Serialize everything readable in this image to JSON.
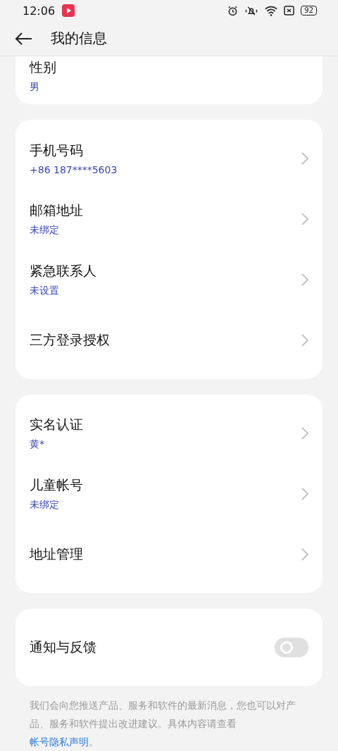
{
  "status_bar": {
    "time": "12:06",
    "battery": "92"
  },
  "header": {
    "title": "我的信息"
  },
  "groups": [
    {
      "items": [
        {
          "title": "性别",
          "value": "男",
          "chevron": false
        }
      ]
    },
    {
      "items": [
        {
          "title": "手机号码",
          "value": "+86 187****5603",
          "chevron": true
        },
        {
          "title": "邮箱地址",
          "value": "未绑定",
          "chevron": true
        },
        {
          "title": "紧急联系人",
          "value": "未设置",
          "chevron": true
        },
        {
          "title": "三方登录授权",
          "chevron": true
        }
      ]
    },
    {
      "items": [
        {
          "title": "实名认证",
          "value": "黄*",
          "chevron": true
        },
        {
          "title": "儿童帐号",
          "value": "未绑定",
          "chevron": true
        },
        {
          "title": "地址管理",
          "chevron": true
        }
      ]
    }
  ],
  "notification": {
    "label": "通知与反馈",
    "on": false
  },
  "footnote": {
    "text": "我们会向您推送产品、服务和软件的最新消息，您也可以对产品、服务和软件提出改进建议。具体内容请查看 ",
    "link": "帐号隐私声明",
    "end": "。"
  }
}
